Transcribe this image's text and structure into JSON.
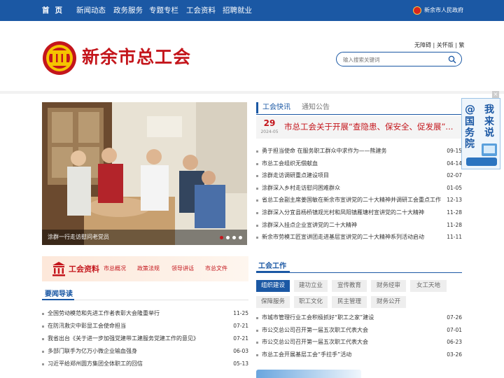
{
  "top_nav": {
    "items": [
      "首页",
      "新闻动态",
      "政务服务",
      "专题专栏",
      "工会资料",
      "招聘就业"
    ],
    "gov_link": "新余市人民政府"
  },
  "header": {
    "site_title": "新余市总工会",
    "access_links": "无障碍 | 关怀版 | 繁",
    "search_placeholder": "输入搜索关键词",
    "logo_icon": "union-emblem-icon"
  },
  "slider": {
    "caption": "涂群一行走访慰问老党员",
    "dot_count": 4,
    "active_dot": 1
  },
  "news": {
    "tabs": [
      "工会快讯",
      "通知公告"
    ],
    "active_tab": 0,
    "headline": {
      "day": "29",
      "month": "2024-05",
      "title": "市总工会关于开展“查隐患、保安全、促发展”..."
    },
    "items": [
      {
        "title": "勇于担当使命 在服务职工群众中求作为——熊建务",
        "date": "09-15"
      },
      {
        "title": "市总工会组织无偿献血",
        "date": "04-14"
      },
      {
        "title": "涂群走访调研重点建设项目",
        "date": "02-07"
      },
      {
        "title": "涂群深入乡村走访慰问困难群众",
        "date": "01-05"
      },
      {
        "title": "省总工会副主席姜国敏在新余市宣讲党的二十大精神并调研工会重点工作",
        "date": "12-13"
      },
      {
        "title": "涂群深入分宜县杨桥镇观光村和凤阳镇雁塘村宣讲党的二十大精神",
        "date": "11-28"
      },
      {
        "title": "涂群深入挂点企业宣讲党的二十大精神",
        "date": "11-28"
      },
      {
        "title": "新余市劳模工匠宣讲团走进基层宣讲党的二十大精神系列活动启动",
        "date": "11-11"
      }
    ]
  },
  "float_widget": {
    "close": "×",
    "text": [
      "@",
      "国",
      "务",
      "院",
      "我",
      "来",
      "说"
    ]
  },
  "resources": {
    "title": "工会资料",
    "links": [
      "市总概况",
      "政策法规",
      "领导讲话",
      "市总文件"
    ]
  },
  "important_news": {
    "title": "要闻导读",
    "items": [
      {
        "title": "全国劳动模范和先进工作者表彰大会隆重举行",
        "date": "11-25"
      },
      {
        "title": "在防汛救灾中彰显工会使命担当",
        "date": "07-21"
      },
      {
        "title": "我省出台《关于进一步加强党建带工建服务党建工作的意见》",
        "date": "07-21"
      },
      {
        "title": "多部门联手为亿万小微企业输血强身",
        "date": "06-03"
      },
      {
        "title": "习近平给郑州圆方集团全体职工的回信",
        "date": "05-13"
      }
    ]
  },
  "union_work": {
    "title": "工会工作",
    "tabs": [
      "组织建设",
      "建功立业",
      "宣传教育",
      "财务经审",
      "女工天地",
      "保障服务",
      "职工文化",
      "民主管理",
      "财务公开"
    ],
    "active_tab": 0,
    "items": [
      {
        "title": "市城市管理行业工会积极抓好“职工之家”建设",
        "date": "07-26"
      },
      {
        "title": "市公交总公司召开第一届五次职工代表大会",
        "date": "07-01"
      },
      {
        "title": "市公交总公司召开第一届五次职工代表大会",
        "date": "06-23"
      },
      {
        "title": "市总工会开展基层工会“手拉手”活动",
        "date": "03-26"
      }
    ]
  },
  "colors": {
    "brand_blue": "#1b58a4",
    "brand_red": "#c4161c"
  }
}
